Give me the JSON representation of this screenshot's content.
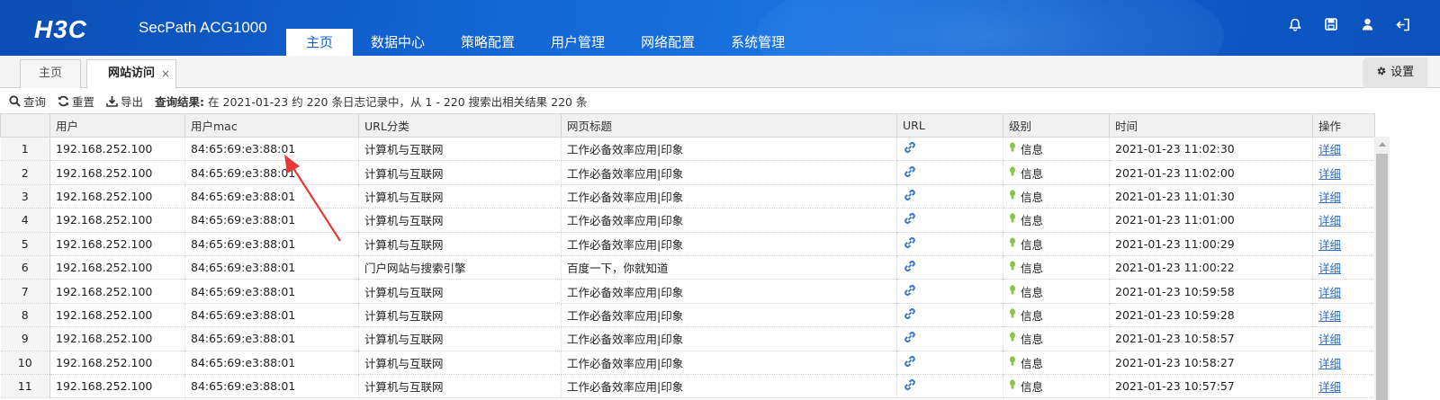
{
  "header": {
    "logo": "H3C",
    "product": "SecPath ACG1000",
    "nav": [
      "主页",
      "数据中心",
      "策略配置",
      "用户管理",
      "网络配置",
      "系统管理"
    ],
    "active_nav": 0
  },
  "tabs": {
    "home": "主页",
    "current": "网站访问",
    "close": "×"
  },
  "settings_label": "设置",
  "toolbar": {
    "query": "查询",
    "reset": "重置",
    "export": "导出",
    "result_label": "查询结果:",
    "result_text": "在 2021-01-23 约 220 条日志记录中，从 1 - 220 搜索出相关结果 220 条"
  },
  "table": {
    "columns": [
      "",
      "用户",
      "用户mac",
      "URL分类",
      "网页标题",
      "URL",
      "级别",
      "时间",
      "操作"
    ],
    "detail_label": "详细",
    "rows": [
      {
        "num": "1",
        "user": "192.168.252.100",
        "mac": "84:65:69:e3:88:01",
        "category": "计算机与互联网",
        "title": "工作必备效率应用|印象",
        "level": "信息",
        "time": "2021-01-23 11:02:30"
      },
      {
        "num": "2",
        "user": "192.168.252.100",
        "mac": "84:65:69:e3:88:01",
        "category": "计算机与互联网",
        "title": "工作必备效率应用|印象",
        "level": "信息",
        "time": "2021-01-23 11:02:00"
      },
      {
        "num": "3",
        "user": "192.168.252.100",
        "mac": "84:65:69:e3:88:01",
        "category": "计算机与互联网",
        "title": "工作必备效率应用|印象",
        "level": "信息",
        "time": "2021-01-23 11:01:30"
      },
      {
        "num": "4",
        "user": "192.168.252.100",
        "mac": "84:65:69:e3:88:01",
        "category": "计算机与互联网",
        "title": "工作必备效率应用|印象",
        "level": "信息",
        "time": "2021-01-23 11:01:00"
      },
      {
        "num": "5",
        "user": "192.168.252.100",
        "mac": "84:65:69:e3:88:01",
        "category": "计算机与互联网",
        "title": "工作必备效率应用|印象",
        "level": "信息",
        "time": "2021-01-23 11:00:29"
      },
      {
        "num": "6",
        "user": "192.168.252.100",
        "mac": "84:65:69:e3:88:01",
        "category": "门户网站与搜索引擎",
        "title": "百度一下，你就知道",
        "level": "信息",
        "time": "2021-01-23 11:00:22"
      },
      {
        "num": "7",
        "user": "192.168.252.100",
        "mac": "84:65:69:e3:88:01",
        "category": "计算机与互联网",
        "title": "工作必备效率应用|印象",
        "level": "信息",
        "time": "2021-01-23 10:59:58"
      },
      {
        "num": "8",
        "user": "192.168.252.100",
        "mac": "84:65:69:e3:88:01",
        "category": "计算机与互联网",
        "title": "工作必备效率应用|印象",
        "level": "信息",
        "time": "2021-01-23 10:59:28"
      },
      {
        "num": "9",
        "user": "192.168.252.100",
        "mac": "84:65:69:e3:88:01",
        "category": "计算机与互联网",
        "title": "工作必备效率应用|印象",
        "level": "信息",
        "time": "2021-01-23 10:58:57"
      },
      {
        "num": "10",
        "user": "192.168.252.100",
        "mac": "84:65:69:e3:88:01",
        "category": "计算机与互联网",
        "title": "工作必备效率应用|印象",
        "level": "信息",
        "time": "2021-01-23 10:58:27"
      },
      {
        "num": "11",
        "user": "192.168.252.100",
        "mac": "84:65:69:e3:88:01",
        "category": "计算机与互联网",
        "title": "工作必备效率应用|印象",
        "level": "信息",
        "time": "2021-01-23 10:57:57"
      }
    ]
  },
  "icons": {
    "header": [
      "bell-icon",
      "save-icon",
      "user-icon",
      "logout-icon"
    ],
    "url": "link-icon",
    "level": "bulb-icon"
  },
  "colors": {
    "header_blue": "#0e5bc8",
    "nav_active_text": "#1565c9",
    "link": "#2a6fc9",
    "annotation_arrow": "#e53935",
    "level_bulb": "#8bc34a"
  }
}
